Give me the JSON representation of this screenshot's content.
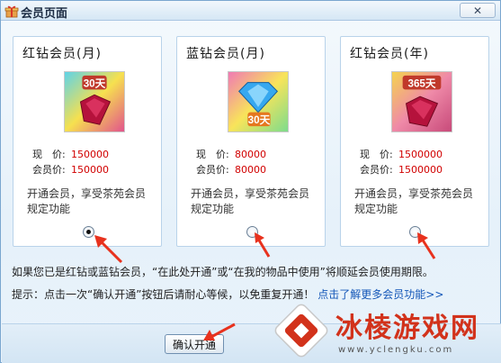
{
  "window": {
    "title": "会员页面",
    "close_label": "✕"
  },
  "cards": [
    {
      "title": "红钻会员(月)",
      "badge": "30天",
      "price_label": "现　价:",
      "price": "150000",
      "member_label": "会员价:",
      "member_price": "150000",
      "desc": "开通会员，享受茶苑会员规定功能",
      "selected": true
    },
    {
      "title": "蓝钻会员(月)",
      "badge": "30天",
      "price_label": "现　价:",
      "price": "80000",
      "member_label": "会员价:",
      "member_price": "80000",
      "desc": "开通会员，享受茶苑会员规定功能",
      "selected": false
    },
    {
      "title": "红钻会员(年)",
      "badge": "365天",
      "price_label": "现　价:",
      "price": "1500000",
      "member_label": "会员价:",
      "member_price": "1500000",
      "desc": "开通会员，享受茶苑会员规定功能",
      "selected": false
    }
  ],
  "notice": "如果您已是红钻或蓝钻会员，“在此处开通”或“在我的物品中使用”将顺延会员使用期限。",
  "tip": {
    "prefix": "提示：点击一次“确认开通”按钮后请耐心等候，以免重复开通！",
    "link": "点击了解更多会员功能>>"
  },
  "confirm_label": "确认开通",
  "watermark": {
    "title": "冰棱游戏网",
    "url": "www.yclengku.com"
  },
  "colors": {
    "price_red": "#d10000",
    "link_blue": "#1457b8",
    "arrow_red": "#e8321e"
  }
}
